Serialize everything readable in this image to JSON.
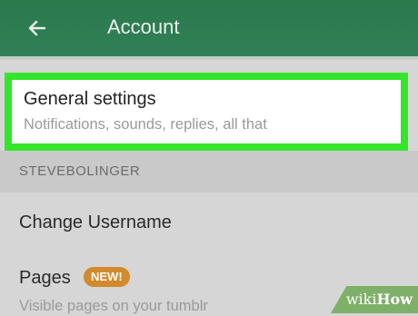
{
  "appbar": {
    "title": "Account",
    "back_icon": "arrow-left-icon",
    "color": "#2a7a4e"
  },
  "general_settings": {
    "title": "General settings",
    "subtitle": "Notifications, sounds, replies, all that",
    "highlight_color": "#35e52b"
  },
  "section": {
    "label": "STEVEBOLINGER"
  },
  "items": [
    {
      "label": "Change Username"
    },
    {
      "label": "Pages",
      "badge": "NEW!",
      "subtitle": "Visible pages on your tumblr"
    }
  ],
  "watermark": {
    "prefix": "wiki",
    "suffix": "How"
  }
}
